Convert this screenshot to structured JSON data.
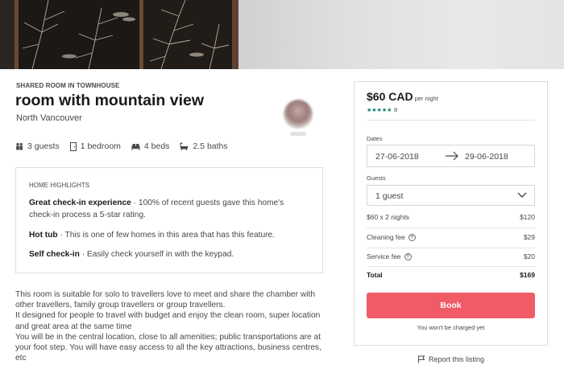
{
  "listing": {
    "type": "SHARED ROOM IN TOWNHOUSE",
    "title": "room with mountain view",
    "location": "North Vancouver"
  },
  "amenities": [
    {
      "icon": "guests-icon",
      "label": "3 guests"
    },
    {
      "icon": "door-icon",
      "label": "1 bedroom"
    },
    {
      "icon": "bed-icon",
      "label": "4 beds"
    },
    {
      "icon": "bath-icon",
      "label": "2.5 baths"
    }
  ],
  "highlights": {
    "heading": "HOME HIGHLIGHTS",
    "items": [
      {
        "title": "Great check-in experience",
        "text": " · 100% of recent guests gave this home's check-in process a 5-star rating."
      },
      {
        "title": "Hot tub",
        "text": " · This is one of few homes in this area that has this feature."
      },
      {
        "title": "Self check-in",
        "text": " · Easily check yourself in with the keypad."
      }
    ]
  },
  "description": [
    "This room is suitable for solo to travellers love to meet and share the chamber with other travellers, family group travellers or group travellers.",
    "It designed for people to travel with budget and enjoy the clean room, super location and great area at the same time",
    "You will be in the central location, close to all amenities; public transportations are at your foot step. You will have easy access to all the key attractions, business centres, etc"
  ],
  "booking": {
    "price": "$60 CAD",
    "per_night": "per night",
    "stars": "★★★★★",
    "rating": 5,
    "review_count": "8",
    "dates_label": "Dates",
    "checkin": "27-06-2018",
    "checkout": "29-06-2018",
    "guests_label": "Guests",
    "guests_value": "1 guest",
    "nights_label": "$60 x 2 nights",
    "nights_amount": "$120",
    "cleaning_label": "Cleaning fee",
    "cleaning_amount": "$29",
    "service_label": "Service fee",
    "service_amount": "$20",
    "total_label": "Total",
    "total_amount": "$169",
    "book_label": "Book",
    "note": "You won't be charged yet"
  },
  "report": {
    "label": "Report this listing"
  },
  "colors": {
    "accent": "#f05b66",
    "stars": "#087a6e"
  }
}
